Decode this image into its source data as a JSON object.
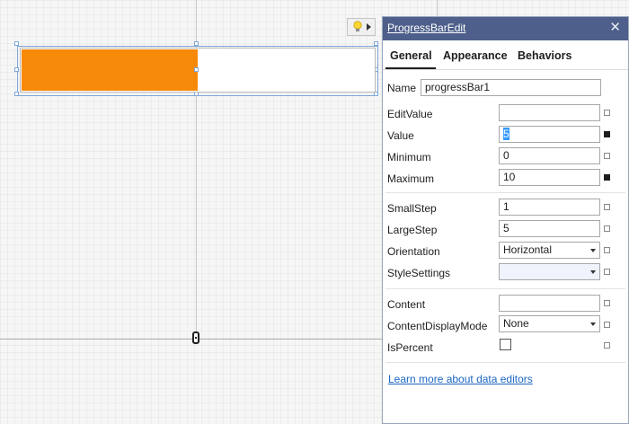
{
  "designer": {
    "progress_value": 5,
    "progress_max": 10,
    "progress_color": "#f78a09",
    "smart_tag_icon": "lightbulb-icon",
    "smart_tag_arrow": "triangle-right-icon"
  },
  "panel": {
    "title": "ProgressBarEdit",
    "close_glyph": "✕",
    "tabs": [
      "General",
      "Appearance",
      "Behaviors"
    ],
    "active_tab": "General",
    "name_label": "Name",
    "name_value": "progressBar1",
    "props": {
      "edit_value": {
        "label": "EditValue",
        "value": ""
      },
      "value": {
        "label": "Value",
        "value": "5"
      },
      "minimum": {
        "label": "Minimum",
        "value": "0"
      },
      "maximum": {
        "label": "Maximum",
        "value": "10"
      },
      "small_step": {
        "label": "SmallStep",
        "value": "1"
      },
      "large_step": {
        "label": "LargeStep",
        "value": "5"
      },
      "orientation": {
        "label": "Orientation",
        "value": "Horizontal"
      },
      "style_settings": {
        "label": "StyleSettings",
        "value": ""
      },
      "content": {
        "label": "Content",
        "value": ""
      },
      "content_display_mode": {
        "label": "ContentDisplayMode",
        "value": "None"
      },
      "is_percent": {
        "label": "IsPercent",
        "checked": false
      }
    },
    "link": "Learn more about data editors"
  }
}
